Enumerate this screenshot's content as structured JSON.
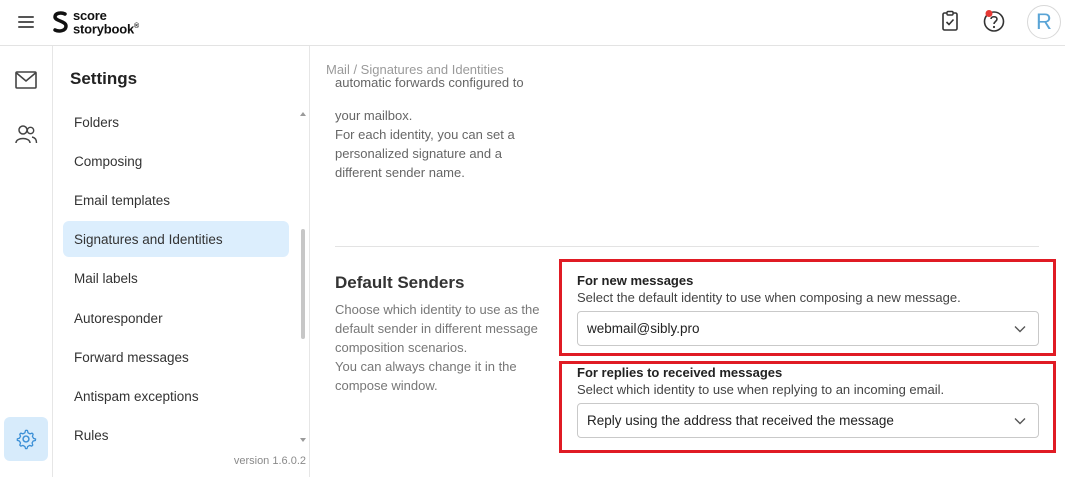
{
  "app": {
    "logo_line1": "score",
    "logo_line2": "storybook",
    "logo_mark": "®"
  },
  "header": {
    "menu_icon": "hamburger-icon",
    "tasks_icon": "clipboard-check-icon",
    "help_icon": "help-icon",
    "avatar_letter": "R"
  },
  "rail": {
    "items": [
      {
        "icon": "mail-icon"
      },
      {
        "icon": "contacts-icon"
      },
      {
        "icon": "gear-icon"
      }
    ]
  },
  "settings": {
    "title": "Settings",
    "items": [
      {
        "label": "Folders"
      },
      {
        "label": "Composing"
      },
      {
        "label": "Email templates"
      },
      {
        "label": "Signatures and Identities"
      },
      {
        "label": "Mail labels"
      },
      {
        "label": "Autoresponder"
      },
      {
        "label": "Forward messages"
      },
      {
        "label": "Antispam exceptions"
      },
      {
        "label": "Rules"
      }
    ],
    "version": "version 1.6.0.2"
  },
  "main": {
    "breadcrumb": "Mail / Signatures and Identities",
    "intro_cut": "automatic forwards configured to",
    "intro_line2": "your mailbox.",
    "intro_line3": "For each identity, you can set a",
    "intro_line4": "personalized signature and a",
    "intro_line5": "different sender name.",
    "default_senders": {
      "title": "Default Senders",
      "desc1": "Choose which identity to use as the",
      "desc2": "default sender in different message",
      "desc3": "composition scenarios.",
      "desc4": "You can always change it in the",
      "desc5": "compose window.",
      "new_messages": {
        "label": "For new messages",
        "help": "Select the default identity to use when composing a new message.",
        "value": "webmail@sibly.pro"
      },
      "replies": {
        "label": "For replies to received messages",
        "help": "Select which identity to use when replying to an incoming email.",
        "value": "Reply using the address that received the message"
      }
    }
  },
  "colors": {
    "highlight": "#e01b24",
    "active_bg": "#dceefd",
    "accent": "#3b8fd6"
  }
}
